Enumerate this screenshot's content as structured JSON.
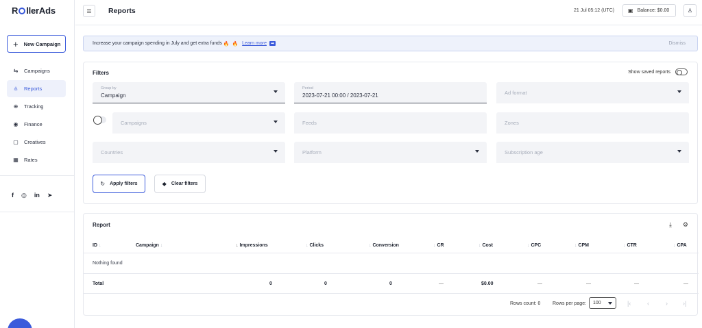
{
  "app": {
    "logo_pre": "R",
    "logo_post": "llerAds",
    "new_campaign_label": "New Campaign"
  },
  "sidebar": {
    "items": [
      {
        "label": "Campaigns",
        "icon": "megaphone-icon",
        "glyph": "⇆"
      },
      {
        "label": "Reports",
        "icon": "chart-icon",
        "glyph": "⫛",
        "active": true
      },
      {
        "label": "Tracking",
        "icon": "tracking-icon",
        "glyph": "⊕"
      },
      {
        "label": "Finance",
        "icon": "finance-icon",
        "glyph": "◉"
      },
      {
        "label": "Creatives",
        "icon": "creatives-icon",
        "glyph": "▢"
      },
      {
        "label": "Rates",
        "icon": "rates-icon",
        "glyph": "▦"
      }
    ],
    "socials": [
      "f",
      "◎",
      "in",
      "➤"
    ]
  },
  "header": {
    "title": "Reports",
    "time": "21 Jul 05:12 (UTC)",
    "balance": "Balance: $0.00"
  },
  "banner": {
    "text": "Increase your campaign spending in July and get extra funds",
    "link": "Learn more",
    "dismiss": "Dismiss"
  },
  "filters": {
    "title": "Filters",
    "show_saved": "Show saved reports",
    "group_by_label": "Group by",
    "group_by_value": "Campaign",
    "period_label": "Period",
    "period_value": "2023-07-21 00:00 / 2023-07-21",
    "ad_format": "Ad format",
    "campaigns": "Campaigns",
    "feeds": "Feeds",
    "zones": "Zones",
    "countries": "Countries",
    "platform": "Platform",
    "subscription_age": "Subscription age",
    "apply": "Apply filters",
    "clear": "Clear filters"
  },
  "report": {
    "title": "Report",
    "columns": [
      "ID",
      "Campaign",
      "Impressions",
      "Clicks",
      "Conversion",
      "CR",
      "Cost",
      "CPC",
      "CPM",
      "CTR",
      "CPA"
    ],
    "empty_text": "Nothing found",
    "total": {
      "label": "Total",
      "impressions": "0",
      "clicks": "0",
      "conversion": "0",
      "cr": "—",
      "cost": "$0.00",
      "cpc": "—",
      "cpm": "—",
      "ctr": "—",
      "cpa": "—"
    },
    "rows_count": "Rows count: 0",
    "rows_per_page_label": "Rows per page:",
    "rows_per_page": "100"
  },
  "colors": {
    "accent": "#3b5bdb",
    "banner_bg": "#eef2fb",
    "field_bg": "#f3f4f7"
  }
}
